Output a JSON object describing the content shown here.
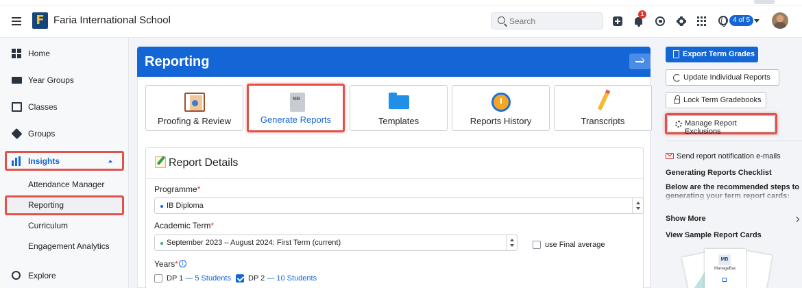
{
  "header": {
    "school_name": "Faria International School",
    "logo_letter": "F",
    "search_placeholder": "Search",
    "notification_count": "1",
    "school_switch_badge": "4 of 5"
  },
  "sidebar": {
    "items": [
      {
        "label": "Home",
        "icon": "home-icon"
      },
      {
        "label": "Year Groups",
        "icon": "year-groups-icon"
      },
      {
        "label": "Classes",
        "icon": "classes-icon"
      },
      {
        "label": "Groups",
        "icon": "groups-icon"
      },
      {
        "label": "Insights",
        "icon": "insights-icon"
      },
      {
        "label": "Explore",
        "icon": "explore-icon"
      }
    ],
    "insights_sub": [
      {
        "label": "Attendance Manager"
      },
      {
        "label": "Reporting"
      },
      {
        "label": "Curriculum"
      },
      {
        "label": "Engagement Analytics"
      }
    ]
  },
  "main": {
    "title": "Reporting",
    "tiles": [
      {
        "label": "Proofing & Review",
        "icon": "proofing-icon"
      },
      {
        "label": "Generate Reports",
        "icon": "generate-reports-icon"
      },
      {
        "label": "Templates",
        "icon": "folder-icon"
      },
      {
        "label": "Reports History",
        "icon": "clock-icon"
      },
      {
        "label": "Transcripts",
        "icon": "pencil-icon"
      }
    ],
    "details": {
      "title": "Report Details",
      "programme_label": "Programme",
      "programme_value": "IB Diploma",
      "term_label": "Academic Term",
      "term_value": "September 2023 – August 2024: First Term (current)",
      "final_average_label": "use Final average",
      "years_label": "Years",
      "req_mark": "*",
      "info_glyph": "i",
      "years": [
        {
          "label": "DP 1",
          "sub": " — 5 Students",
          "checked": false
        },
        {
          "label": "DP 2",
          "sub": " — 10 Students",
          "checked": true
        }
      ]
    }
  },
  "right": {
    "export_label": "Export Term Grades",
    "update_label": "Update Individual Reports",
    "lock_label": "Lock Term Gradebooks",
    "exclusions_label": "Manage Report Exclusions",
    "notify_label": "Send report notification e-mails",
    "checklist_title": "Generating Reports Checklist",
    "checklist_text": "Below are the recommended steps to",
    "checklist_text_faded": "generating your term report cards:",
    "show_more_label": "Show More",
    "sample_label": "View Sample Report Cards",
    "sample_logo": "MB",
    "sample_brand": "ManageBac"
  },
  "colors": {
    "accent": "#1466d6",
    "highlight": "#e0524b",
    "badge": "#e0362c"
  }
}
